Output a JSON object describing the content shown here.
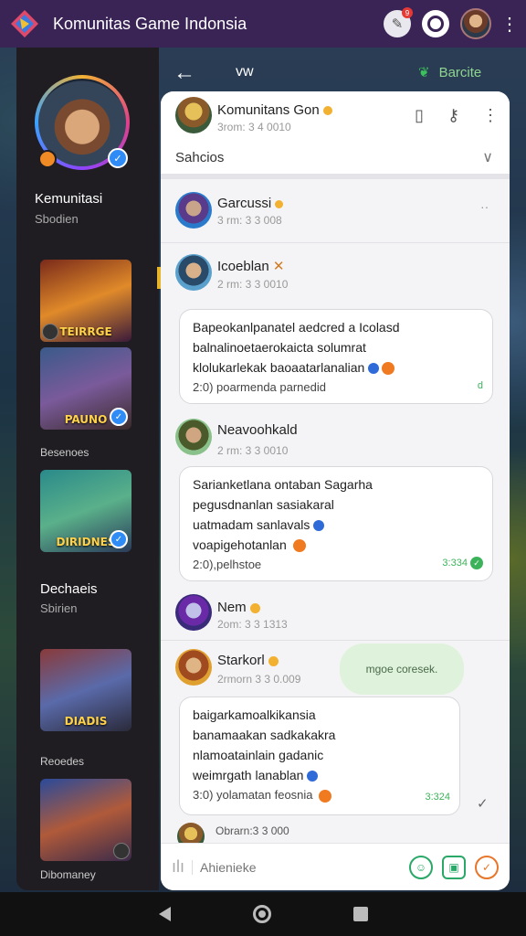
{
  "app": {
    "title": "Komunitas Game Indonsia"
  },
  "topbar": {
    "notification_count": "9"
  },
  "left_panel": {
    "profile_name": "Kemunitasi",
    "profile_sub": "Sbodien",
    "games": [
      {
        "label": "TEIRRGE"
      },
      {
        "label": "PAUNO"
      },
      {
        "label": "DIRIDNES"
      },
      {
        "label": "DIADIS"
      },
      {
        "label": ""
      }
    ],
    "sections": [
      {
        "label": "Besenoes"
      },
      {
        "title": "Dechaeis",
        "sub": "Sbirien"
      },
      {
        "label": "Reoedes"
      },
      {
        "label": "Dibomaney"
      }
    ]
  },
  "header": {
    "back_icon": "arrow-left-icon",
    "title": "vw",
    "action_label": "Barcite"
  },
  "chat": {
    "group": {
      "name": "Komunitans Gon",
      "time": "3rom: 3 4 0010"
    },
    "row_title": "Sahcios",
    "messages": [
      {
        "name": "Garcussi",
        "time": "3 rm: 3 3 008"
      },
      {
        "name": "Icoeblan",
        "time": "2 rm: 3 3 0010",
        "lines": [
          "Bapeokanlpanatel aedcred a Icolasd",
          "balnalinoetaerokaicta solumrat",
          "klolukarlekak baoaatarlanalian"
        ],
        "footer": "2:0) poarmenda parnedid",
        "meta": "d"
      },
      {
        "name": "Neavoohkald",
        "time": "2 rm: 3 3 0010",
        "lines": [
          "Sarianketlana ontaban Sagarha",
          "pegusdnanlan sasiakaral",
          "uatmadam sanlavals",
          "voapigehotanlan"
        ],
        "footer": "2:0),pelhstoe",
        "meta": "3:334"
      },
      {
        "name": "Nem",
        "time": "2om: 3 3 1313"
      },
      {
        "name": "Starkorl",
        "time": "2rmorn 3 3 0.009",
        "chip": "mgoe coresek.",
        "lines": [
          "baigarkamoalkikansia",
          "banamaakan sadkakakra",
          "nlamoatainlain gadanic",
          "weimrgath lanablan"
        ],
        "footer": "3:0) yolamatan feosnia",
        "meta": "3:324"
      },
      {
        "name": "Obrarn:3 3 000",
        "time": ""
      }
    ]
  },
  "compose": {
    "placeholder": "Ahienieke"
  }
}
